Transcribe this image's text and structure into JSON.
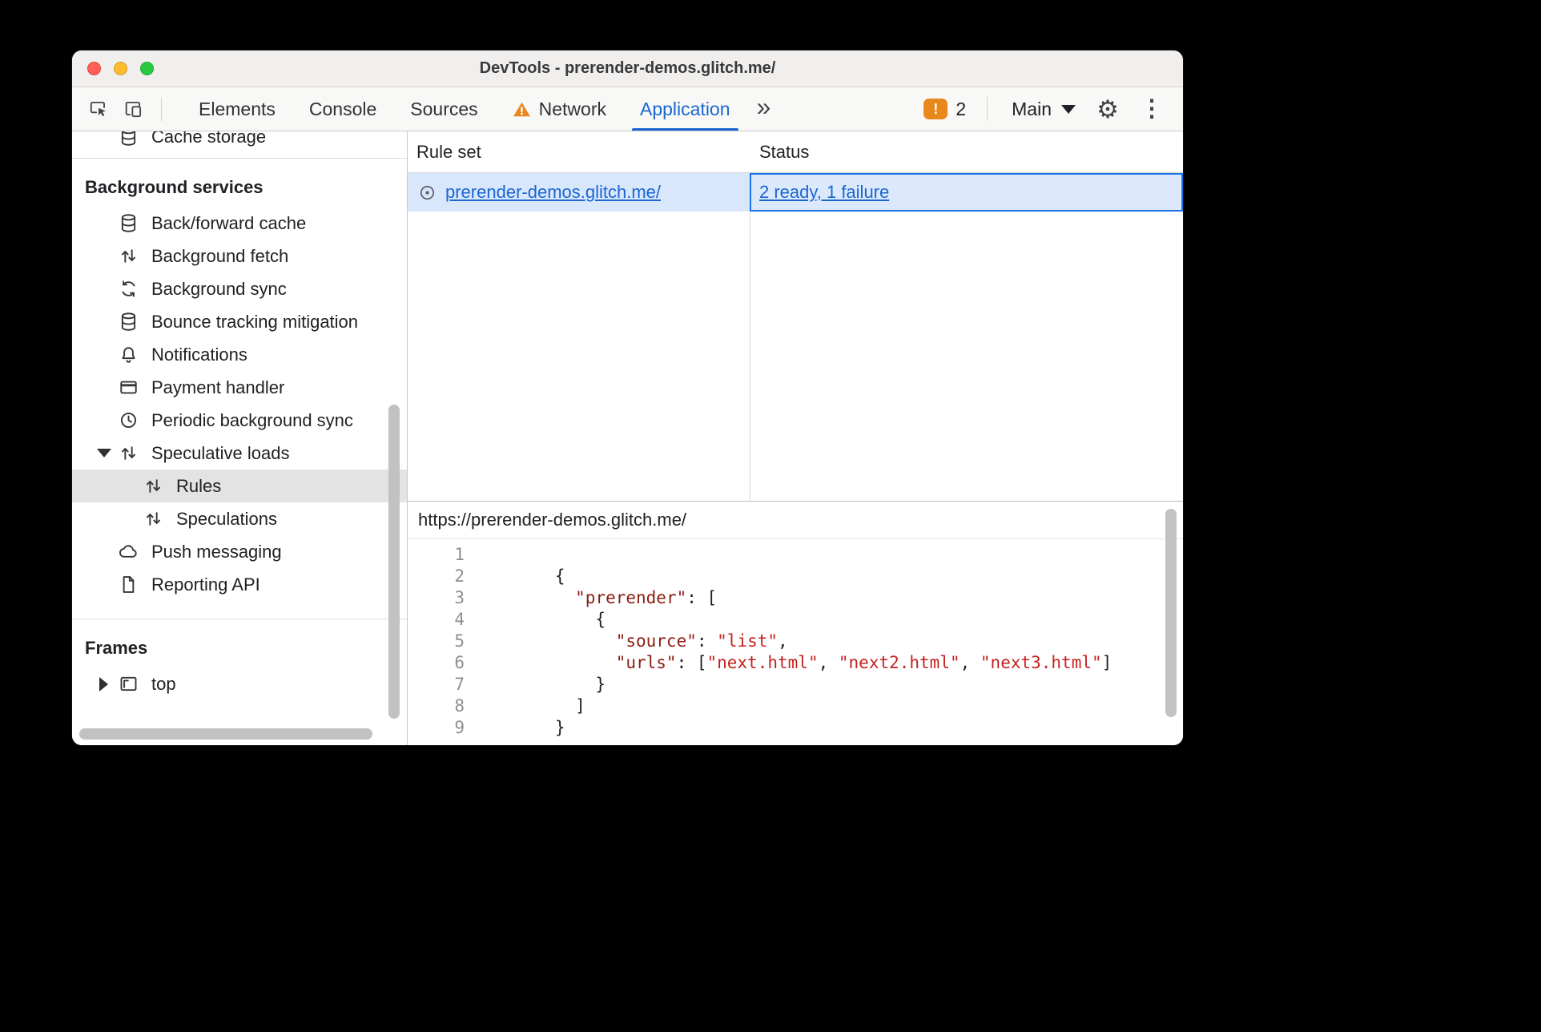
{
  "window": {
    "title": "DevTools - prerender-demos.glitch.me/"
  },
  "toolbar": {
    "tabs": [
      {
        "label": "Elements"
      },
      {
        "label": "Console"
      },
      {
        "label": "Sources"
      },
      {
        "label": "Network",
        "warning": true
      },
      {
        "label": "Application",
        "active": true
      }
    ],
    "more_tabs_glyph": "»",
    "issues": {
      "count": "2",
      "glyph": "!"
    },
    "context_selector": {
      "label": "Main"
    },
    "gear_glyph": "⚙",
    "kebab_glyph": "⋮"
  },
  "sidebar": {
    "clipped_item": {
      "label": "Cache storage",
      "icon": "database"
    },
    "sections": [
      {
        "title": "Background services",
        "items": [
          {
            "label": "Back/forward cache",
            "icon": "database"
          },
          {
            "label": "Background fetch",
            "icon": "updown"
          },
          {
            "label": "Background sync",
            "icon": "sync"
          },
          {
            "label": "Bounce tracking mitigation",
            "icon": "database"
          },
          {
            "label": "Notifications",
            "icon": "bell"
          },
          {
            "label": "Payment handler",
            "icon": "card"
          },
          {
            "label": "Periodic background sync",
            "icon": "clock"
          },
          {
            "label": "Speculative loads",
            "icon": "updown",
            "disclosure": "expanded"
          },
          {
            "label": "Rules",
            "icon": "updown",
            "indent": 1,
            "selected": true
          },
          {
            "label": "Speculations",
            "icon": "updown",
            "indent": 1
          },
          {
            "label": "Push messaging",
            "icon": "cloud"
          },
          {
            "label": "Reporting API",
            "icon": "file"
          }
        ]
      },
      {
        "title": "Frames",
        "items": [
          {
            "label": "top",
            "icon": "frame",
            "disclosure": "collapsed"
          }
        ]
      }
    ]
  },
  "rule_sets": {
    "columns": [
      "Rule set",
      "Status"
    ],
    "rows": [
      {
        "rule_set": "prerender-demos.glitch.me/",
        "status": "2 ready, 1 failure"
      }
    ]
  },
  "source_view": {
    "url": "https://prerender-demos.glitch.me/",
    "lines": [
      {
        "n": "1",
        "tokens": []
      },
      {
        "n": "2",
        "tokens": [
          [
            "p",
            "      {"
          ]
        ]
      },
      {
        "n": "3",
        "tokens": [
          [
            "p",
            "        "
          ],
          [
            "k",
            "\"prerender\""
          ],
          [
            "p",
            ": ["
          ]
        ]
      },
      {
        "n": "4",
        "tokens": [
          [
            "p",
            "          {"
          ]
        ]
      },
      {
        "n": "5",
        "tokens": [
          [
            "p",
            "            "
          ],
          [
            "k",
            "\"source\""
          ],
          [
            "p",
            ": "
          ],
          [
            "s",
            "\"list\""
          ],
          [
            "p",
            ","
          ]
        ]
      },
      {
        "n": "6",
        "tokens": [
          [
            "p",
            "            "
          ],
          [
            "k",
            "\"urls\""
          ],
          [
            "p",
            ": ["
          ],
          [
            "s",
            "\"next.html\""
          ],
          [
            "p",
            ", "
          ],
          [
            "s",
            "\"next2.html\""
          ],
          [
            "p",
            ", "
          ],
          [
            "s",
            "\"next3.html\""
          ],
          [
            "p",
            "]"
          ]
        ]
      },
      {
        "n": "7",
        "tokens": [
          [
            "p",
            "          }"
          ]
        ]
      },
      {
        "n": "8",
        "tokens": [
          [
            "p",
            "        ]"
          ]
        ]
      },
      {
        "n": "9",
        "tokens": [
          [
            "p",
            "      }"
          ]
        ]
      }
    ]
  },
  "colors": {
    "accent_blue": "#1a66d2",
    "warning_orange": "#e8871a",
    "row_selection_blue": "#d9e7fd",
    "sidebar_selection_gray": "#e3e3e3"
  }
}
